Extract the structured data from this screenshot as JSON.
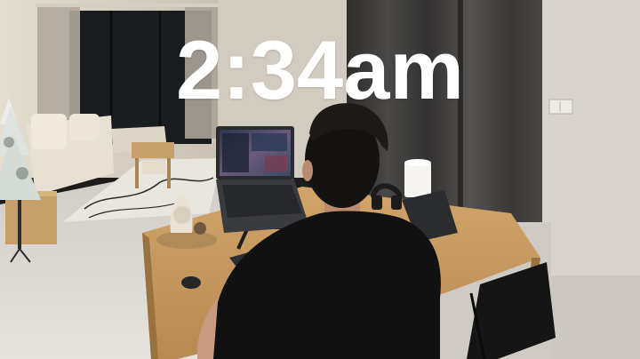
{
  "overlay": {
    "time_text": "2:34am"
  },
  "scene": {
    "colors": {
      "wall_left": "#c9c2b6",
      "wall_right": "#d7d3cc",
      "curtain": "#3c3b3a",
      "window_dark": "#1a1d20",
      "floor": "#d8d4cd",
      "desk": "#c99a5e",
      "shirt": "#111111",
      "hair": "#151311",
      "skin": "#c89a80",
      "laptop": "#2a2b2e"
    }
  }
}
